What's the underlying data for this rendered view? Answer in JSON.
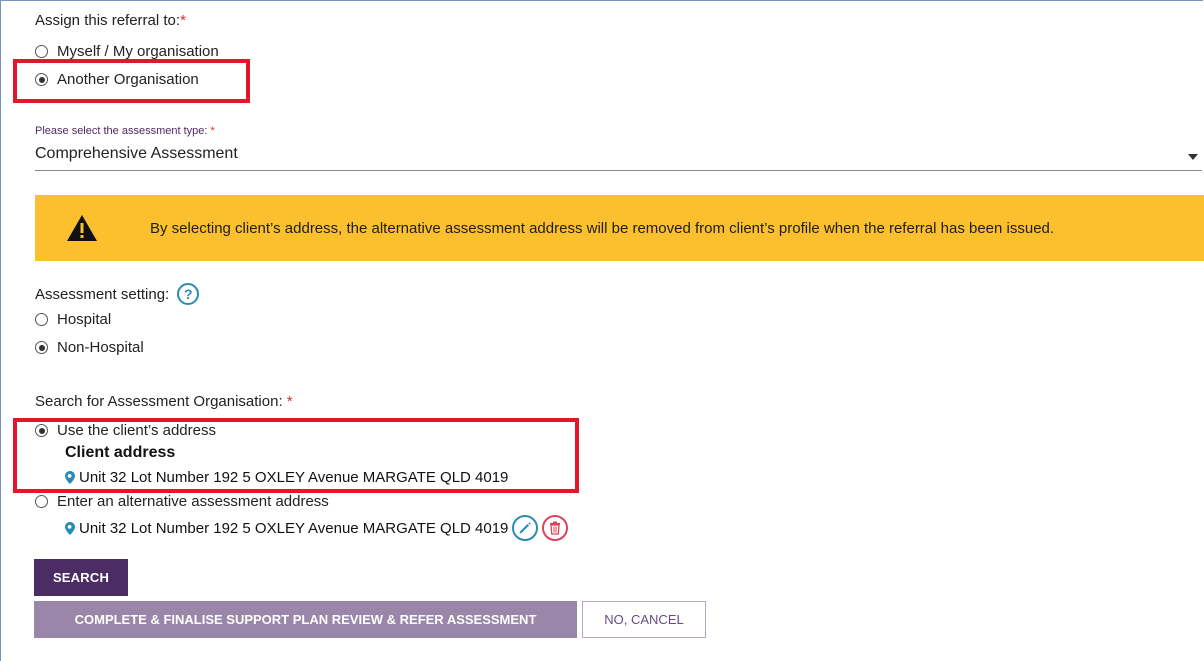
{
  "assign": {
    "label": "Assign this referral to:",
    "required_mark": "*",
    "options": [
      "Myself / My organisation",
      "Another Organisation"
    ],
    "selected": "Another Organisation"
  },
  "assessment_type": {
    "label": "Please select the assessment type:",
    "required_mark": "*",
    "value": "Comprehensive Assessment"
  },
  "warning": {
    "text": "By selecting client’s address, the alternative assessment address will be removed from client’s profile when the referral has been issued."
  },
  "setting": {
    "label": "Assessment setting:",
    "help_glyph": "?",
    "options": [
      "Hospital",
      "Non-Hospital"
    ],
    "selected": "Non-Hospital"
  },
  "search_org": {
    "label": "Search for Assessment Organisation:",
    "required_mark": "*",
    "options": [
      "Use the client’s address",
      "Enter an alternative assessment address"
    ],
    "selected": "Use the client’s address",
    "client_address_heading": "Client address",
    "client_address": "Unit 32 Lot Number 192 5 OXLEY Avenue MARGATE QLD 4019",
    "alt_address": "Unit 32 Lot Number 192 5 OXLEY Avenue MARGATE QLD 4019"
  },
  "buttons": {
    "search": "SEARCH",
    "complete": "COMPLETE & FINALISE SUPPORT PLAN REVIEW & REFER ASSESSMENT",
    "cancel": "NO, CANCEL"
  },
  "colors": {
    "primary": "#4b2c63",
    "warning_bg": "#fcbf2e",
    "highlight": "#e3172a",
    "help_icon": "#2a8bb3",
    "delete_icon": "#e0405a"
  }
}
